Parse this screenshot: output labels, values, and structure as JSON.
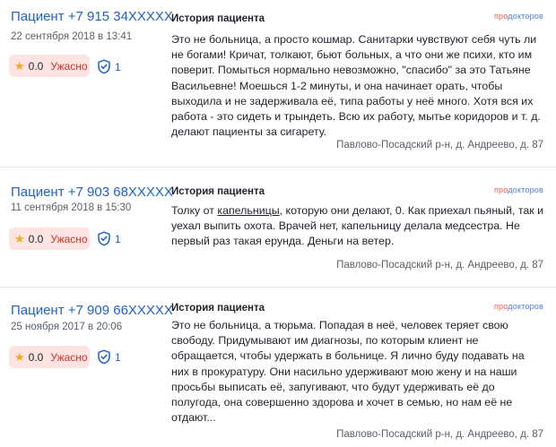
{
  "brand": {
    "part1": "про",
    "part2": "докторов"
  },
  "colors": {
    "author_link": "#1e62c9",
    "rating_bad": "#d2342a",
    "badge_bg": "#fde3e1",
    "star": "#f4a81c"
  },
  "icons": {
    "rating": "star-icon",
    "verified": "shield-check-icon"
  },
  "reviews": [
    {
      "author": "Пациент +7 915 34XXXXX",
      "date": "22 сентября 2018 в 13:41",
      "rating_value": "0.0",
      "rating_word": "Ужасно",
      "verified_count": "1",
      "section_title": "История пациента",
      "text": "Это не больница, а просто кошмар. Санитарки чувствуют себя чуть ли не богами! Кричат, толкают, бьют больных, а что они же психи, кто им поверит. Помыться нормально невозможно, \"спасибо\" за это Татьяне Васильевне! Моешься 1-2 минуты, и она начинает орать, чтобы выходила и не задерживала её, типа работы у неё много. Хотя вся их работа - это сидеть и трындеть. Всю их работу, мытье коридоров и т. д. делают пациенты за сигарету.",
      "address": "Павлово-Посадский р-н, д. Андреево, д. 87"
    },
    {
      "author": "Пациент +7 903 68XXXXX",
      "date": "11 сентября 2018 в 15:30",
      "rating_value": "0.0",
      "rating_word": "Ужасно",
      "verified_count": "1",
      "section_title": "История пациента",
      "text_pre": "Толку от ",
      "text_link": "капельницы",
      "text_post": ", которую они делают, 0. Как приехал пьяный, так и уехал выпить охота. Врачей нет, капельницу делала медсестра. Не первый раз такая ерунда. Деньги на ветер.",
      "address": "Павлово-Посадский р-н, д. Андреево, д. 87"
    },
    {
      "author": "Пациент +7 909 66XXXXX",
      "date": "25 ноября 2017 в 20:06",
      "rating_value": "0.0",
      "rating_word": "Ужасно",
      "verified_count": "1",
      "section_title": "История пациента",
      "text": "Это не больница, а тюрьма. Попадая в неё, человек теряет свою свободу. Придумывают им диагнозы, по которым клиент не обращается, чтобы удержать в больнице. Я лично буду подавать на них в прокуратуру. Они насильно удерживают мою жену и на наши просьбы выписать её, запугивают, что будут удерживать её до полугода, она совершенно здорова и хочет в семью, но нам её не отдают...",
      "address": "Павлово-Посадский р-н, д. Андреево, д. 87"
    }
  ]
}
